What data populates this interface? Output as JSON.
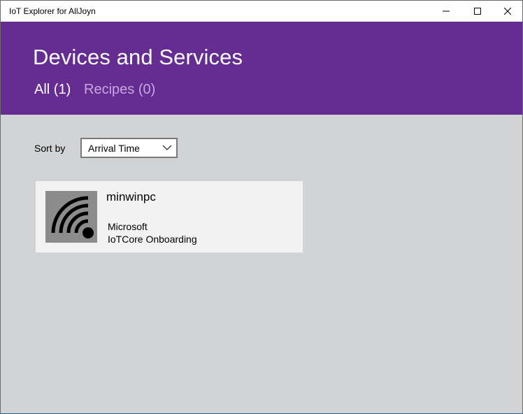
{
  "window": {
    "title": "IoT Explorer for AllJoyn",
    "controls": {
      "minimize": "minimize-icon",
      "maximize": "maximize-icon",
      "close": "close-icon"
    }
  },
  "header": {
    "title": "Devices and Services",
    "tabs": [
      {
        "label": "All (1)",
        "selected": true
      },
      {
        "label": "Recipes (0)",
        "selected": false
      }
    ],
    "colors": {
      "background": "#652c91",
      "active_tab": "#ffffff",
      "inactive_tab": "#c9a7e3"
    }
  },
  "sort": {
    "label": "Sort by",
    "selected": "Arrival Time",
    "icon": "chevron-down-icon"
  },
  "devices": [
    {
      "name": "minwinpc",
      "manufacturer": "Microsoft",
      "model": "IoTCore Onboarding",
      "icon": "wifi-signal-icon"
    }
  ]
}
